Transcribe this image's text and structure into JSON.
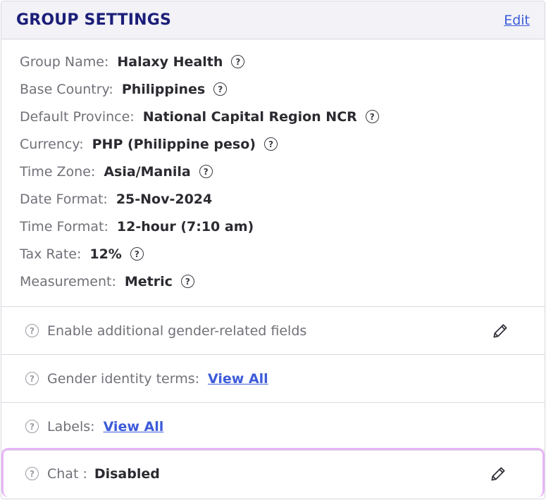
{
  "header": {
    "title": "GROUP SETTINGS",
    "edit_label": "Edit"
  },
  "settings": [
    {
      "label": "Group Name:",
      "value": "Halaxy Health",
      "help": true
    },
    {
      "label": "Base Country:",
      "value": "Philippines",
      "help": true
    },
    {
      "label": "Default Province:",
      "value": "National Capital Region NCR",
      "help": true
    },
    {
      "label": "Currency:",
      "value": "PHP (Philippine peso)",
      "help": true
    },
    {
      "label": "Time Zone:",
      "value": "Asia/Manila",
      "help": true
    },
    {
      "label": "Date Format:",
      "value": "25-Nov-2024",
      "help": false
    },
    {
      "label": "Time Format:",
      "value": "12-hour (7:10 am)",
      "help": false
    },
    {
      "label": "Tax Rate:",
      "value": "12%",
      "help": true
    },
    {
      "label": "Measurement:",
      "value": "Metric",
      "help": true
    }
  ],
  "sections": {
    "gender_fields": {
      "label": "Enable additional gender-related fields"
    },
    "gender_terms": {
      "label": "Gender identity terms:",
      "link": "View All"
    },
    "labels": {
      "label": "Labels:",
      "link": "View All"
    },
    "chat": {
      "label": "Chat :",
      "value": "Disabled"
    }
  },
  "icons": {
    "help": "question-circle-icon",
    "edit": "pencil-icon"
  },
  "colors": {
    "title": "#1b1e78",
    "link": "#3d5bd9",
    "highlight_border": "#e7b5f5",
    "header_bg": "#f2f2f7"
  }
}
